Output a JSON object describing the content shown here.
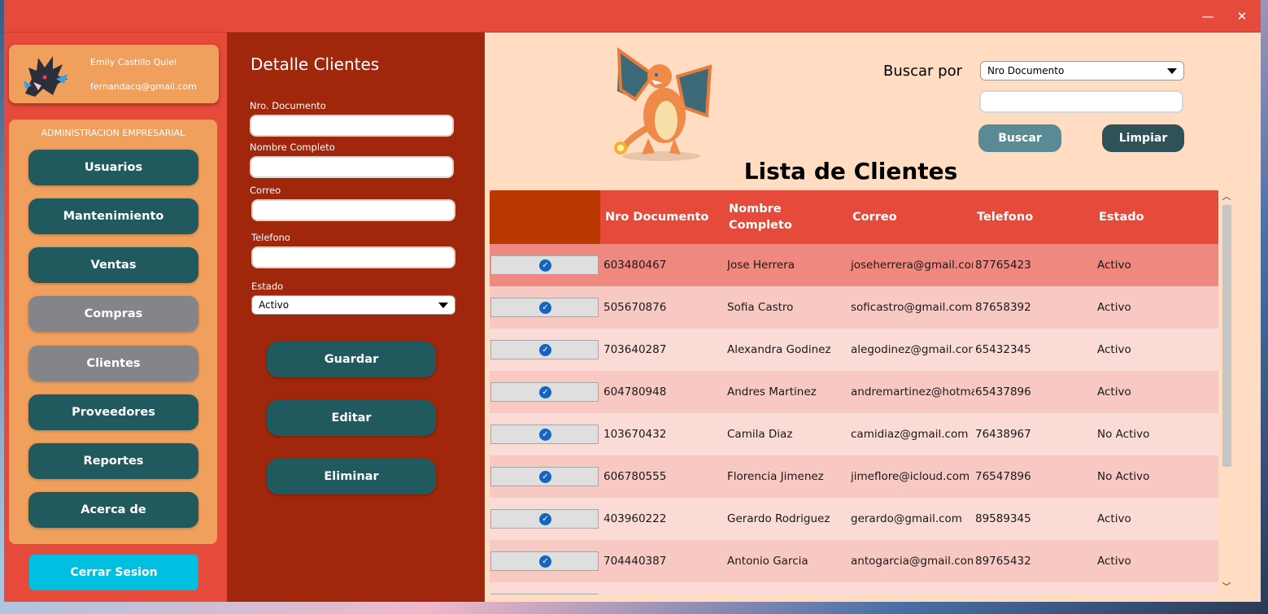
{
  "window": {
    "minimize": "—",
    "close": "✕"
  },
  "profile": {
    "name": "Emily Castillo Quiel",
    "email": "fernandacq@gmail.com"
  },
  "menu": {
    "title": "ADMINISTRACION EMPRESARIAL",
    "items": [
      {
        "label": "Usuarios",
        "style": "dark"
      },
      {
        "label": "Mantenimiento",
        "style": "dark"
      },
      {
        "label": "Ventas",
        "style": "dark"
      },
      {
        "label": "Compras",
        "style": "gray"
      },
      {
        "label": "Clientes",
        "style": "gray"
      },
      {
        "label": "Proveedores",
        "style": "dark"
      },
      {
        "label": "Reportes",
        "style": "dark"
      },
      {
        "label": "Acerca de",
        "style": "dark"
      }
    ],
    "logout": "Cerrar Sesion"
  },
  "detail": {
    "title": "Detalle Clientes",
    "documento_label": "Nro. Documento",
    "nombre_label": "Nombre Completo",
    "correo_label": "Correo",
    "telefono_label": "Telefono",
    "estado_label": "Estado",
    "estado_value": "Activo",
    "guardar": "Guardar",
    "editar": "Editar",
    "eliminar": "Eliminar"
  },
  "search": {
    "label": "Buscar por",
    "selected": "Nro Documento",
    "buscar": "Buscar",
    "limpiar": "Limpiar"
  },
  "list": {
    "title": "Lista de Clientes",
    "columns": [
      "Nro Documento",
      "Nombre Completo",
      "Correo",
      "Telefono",
      "Estado"
    ],
    "rows": [
      {
        "doc": "603480467",
        "nombre": "Jose Herrera",
        "correo": "joseherrera@gmail.com",
        "tel": "87765423",
        "estado": "Activo"
      },
      {
        "doc": "505670876",
        "nombre": "Sofia Castro",
        "correo": "soficastro@gmail.com",
        "tel": "87658392",
        "estado": "Activo"
      },
      {
        "doc": "703640287",
        "nombre": "Alexandra Godinez",
        "correo": "alegodinez@gmail.com",
        "tel": "65432345",
        "estado": "Activo"
      },
      {
        "doc": "604780948",
        "nombre": "Andres Martinez",
        "correo": "andremartinez@hotmail.",
        "tel": "65437896",
        "estado": "Activo"
      },
      {
        "doc": "103670432",
        "nombre": "Camila Diaz",
        "correo": "camidiaz@gmail.com",
        "tel": "76438967",
        "estado": "No Activo"
      },
      {
        "doc": "606780555",
        "nombre": "Florencia Jimenez",
        "correo": "jimeflore@icloud.com",
        "tel": "76547896",
        "estado": "No Activo"
      },
      {
        "doc": "403960222",
        "nombre": "Gerardo Rodriguez",
        "correo": "gerardo@gmail.com",
        "tel": "89589345",
        "estado": "Activo"
      },
      {
        "doc": "704440387",
        "nombre": "Antonio Garcia",
        "correo": "antogarcia@gmail.com",
        "tel": "89765432",
        "estado": "Activo"
      }
    ]
  },
  "colors": {
    "titlebar": "#e54a3a",
    "sidebar_panel": "#f0a05c",
    "button_dark": "#215a5e",
    "button_disabled": "#84858a",
    "detail_panel": "#a0260c",
    "main_panel": "#ffdcc2",
    "logout": "#00bfe0"
  },
  "icons": {
    "check": "check-circle-icon",
    "avatar": "dragon-avatar-icon",
    "mascot": "charizard-image"
  }
}
